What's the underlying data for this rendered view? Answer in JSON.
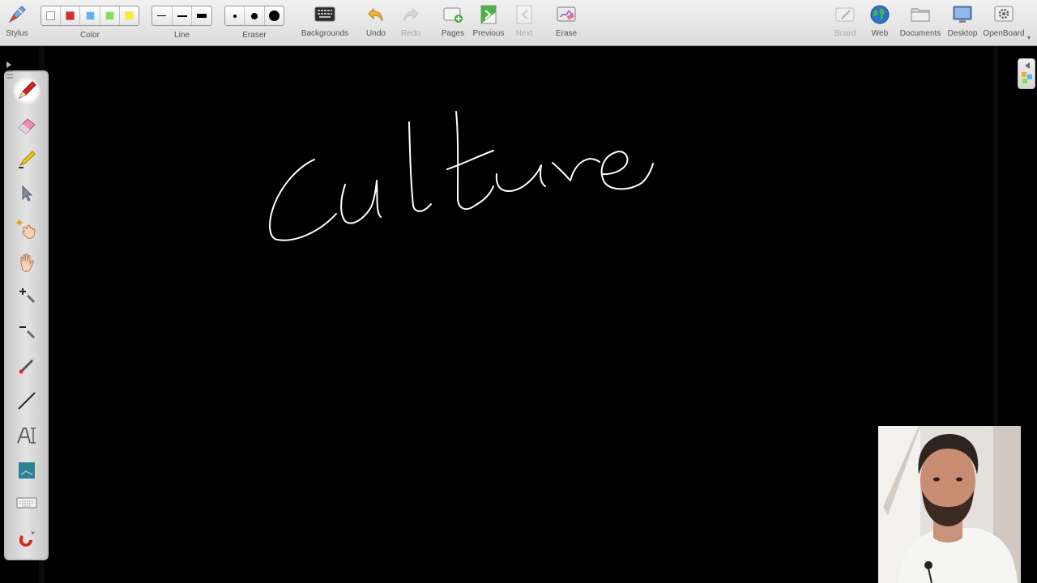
{
  "toolbar": {
    "stylus": {
      "label": "Stylus",
      "icon": "stylus-icon"
    },
    "color": {
      "label": "Color",
      "swatches": [
        "#ffffff",
        "#e8251c",
        "#5fb2f2",
        "#7ee05c",
        "#f6ee2e"
      ],
      "selected_index": 0
    },
    "line": {
      "label": "Line",
      "sizes": [
        "thin",
        "medium",
        "thick"
      ]
    },
    "eraser": {
      "label": "Eraser",
      "sizes": [
        "small",
        "medium",
        "large"
      ]
    },
    "backgrounds": {
      "label": "Backgrounds",
      "icon": "keyboard-background-icon"
    },
    "undo": {
      "label": "Undo",
      "icon": "undo-arrow-icon"
    },
    "redo": {
      "label": "Redo",
      "icon": "redo-arrow-icon",
      "disabled": true
    },
    "pages": {
      "label": "Pages",
      "icon": "add-page-icon"
    },
    "previous": {
      "label": "Previous",
      "icon": "previous-page-icon"
    },
    "next": {
      "label": "Next",
      "icon": "next-page-icon",
      "disabled": true
    },
    "erase": {
      "label": "Erase",
      "icon": "erase-board-icon"
    },
    "board": {
      "label": "Board",
      "icon": "board-icon",
      "disabled": true
    },
    "web": {
      "label": "Web",
      "icon": "globe-icon"
    },
    "documents": {
      "label": "Documents",
      "icon": "folder-icon"
    },
    "desktop": {
      "label": "Desktop",
      "icon": "monitor-icon"
    },
    "openboard": {
      "label": "OpenBoard",
      "icon": "gear-icon"
    }
  },
  "palette": {
    "tools": [
      {
        "name": "pen",
        "icon": "pen-icon",
        "active": true
      },
      {
        "name": "eraser",
        "icon": "eraser-icon"
      },
      {
        "name": "highlighter",
        "icon": "highlighter-icon"
      },
      {
        "name": "selector",
        "icon": "pointer-arrow-icon"
      },
      {
        "name": "interact",
        "icon": "interact-hand-icon"
      },
      {
        "name": "hand",
        "icon": "hand-icon"
      },
      {
        "name": "zoom-in",
        "icon": "zoom-in-icon"
      },
      {
        "name": "zoom-out",
        "icon": "zoom-out-icon"
      },
      {
        "name": "laser",
        "icon": "laser-pointer-icon"
      },
      {
        "name": "line",
        "icon": "line-tool-icon"
      },
      {
        "name": "text",
        "icon": "text-tool-icon"
      },
      {
        "name": "capture",
        "icon": "capture-icon"
      },
      {
        "name": "keyboard",
        "icon": "virtual-keyboard-icon"
      },
      {
        "name": "magnet",
        "icon": "magnet-icon"
      }
    ]
  },
  "board": {
    "background_color": "#000000",
    "ink_color": "#ffffff",
    "handwritten_text": "culture"
  },
  "webcam": {
    "description_icon": "presenter-webcam"
  }
}
